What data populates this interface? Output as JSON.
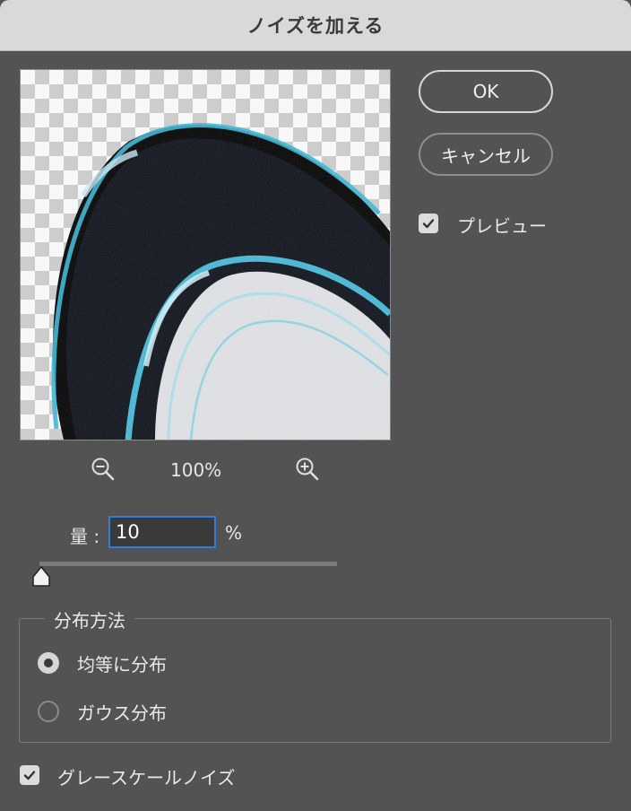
{
  "dialog": {
    "title": "ノイズを加える"
  },
  "buttons": {
    "ok": "OK",
    "cancel": "キャンセル"
  },
  "preview_option": {
    "label": "プレビュー",
    "checked": true
  },
  "zoom": {
    "level": "100%",
    "zoom_out_icon": "magnifier-minus-icon",
    "zoom_in_icon": "magnifier-plus-icon"
  },
  "amount": {
    "label": "量 :",
    "value": "10",
    "unit": "%",
    "slider_fraction": 0.025
  },
  "distribution": {
    "title": "分布方法",
    "options": [
      {
        "label": "均等に分布",
        "selected": true
      },
      {
        "label": "ガウス分布",
        "selected": false
      }
    ]
  },
  "grayscale_option": {
    "label": "グレースケールノイズ",
    "checked": true
  },
  "colors": {
    "background": "#535353",
    "titlebar": "#d9d9d9",
    "focus": "#2f7ed8"
  }
}
